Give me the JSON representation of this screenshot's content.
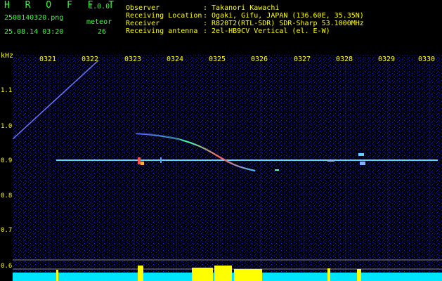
{
  "header": {
    "app_title": "H R O F F T",
    "version": "1.0.0",
    "filename": "2508140320.png",
    "datetime": "25.08.14 03:20",
    "meteor_label": "meteor",
    "meteor_count": "26",
    "fields": [
      {
        "label": "Observer",
        "value": ": Takanori Kawachi"
      },
      {
        "label": "Receiving Location",
        "value": ": Ogaki, Gifu, JAPAN (136.60E, 35.35N)"
      },
      {
        "label": "Receiver",
        "value": ": R820T2(RTL-SDR) SDR-Sharp 53.1000MHz"
      },
      {
        "label": "Receiving antenna",
        "value": ": 2el-HB9CV Vertical (el. E-W)"
      }
    ]
  },
  "spectrogram": {
    "y_unit": "kHz",
    "time_ticks": [
      "0321",
      "0322",
      "0323",
      "0324",
      "0325",
      "0326",
      "0327",
      "0328",
      "0329",
      "0330"
    ],
    "freq_ticks": [
      "1.1",
      "1.0",
      "0.9",
      "0.8",
      "0.7",
      "0.6"
    ],
    "colors": {
      "label": "#ffff00",
      "info": "#33ff33",
      "noise_bar": "#00e5ff",
      "signal": "#ffffff"
    }
  }
}
